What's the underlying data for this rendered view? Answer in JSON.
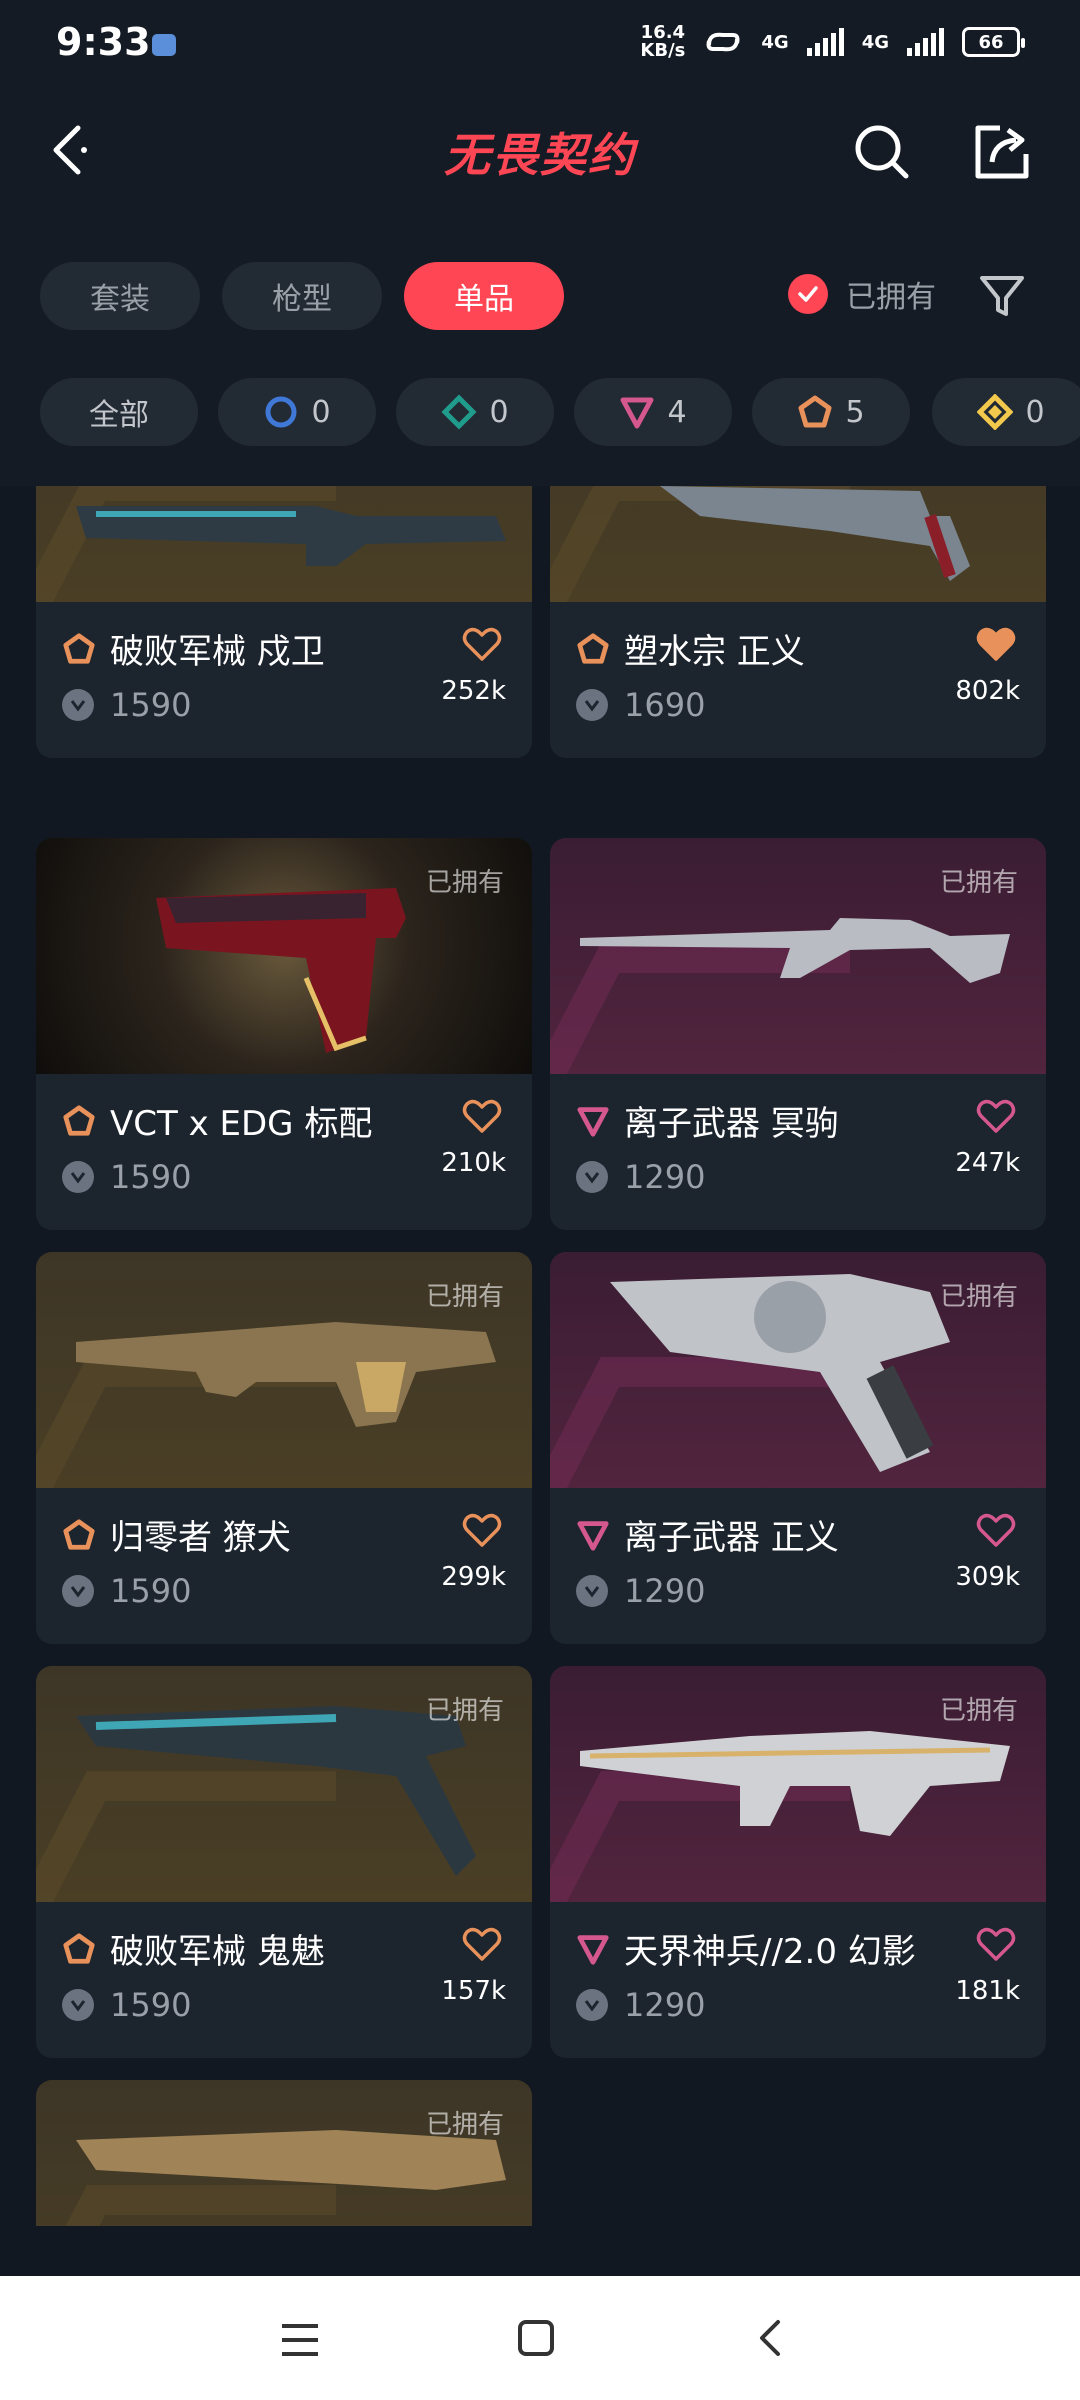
{
  "status_bar": {
    "time": "9:33",
    "net_speed_value": "16.4",
    "net_speed_unit": "KB/s",
    "signal_1": "4G",
    "signal_2": "4G",
    "battery": "66"
  },
  "header": {
    "title": "无畏契约",
    "back_icon": "chevron-left-icon",
    "search_icon": "search-icon",
    "share_icon": "share-icon"
  },
  "tabs": [
    {
      "label": "套装",
      "active": false
    },
    {
      "label": "枪型",
      "active": false
    },
    {
      "label": "单品",
      "active": true
    }
  ],
  "owned_filter": {
    "label": "已拥有",
    "checked": true
  },
  "tier_filters": [
    {
      "label": "全部",
      "icon": ""
    },
    {
      "label": "0",
      "icon": "select-tier-icon",
      "color": "#3f78d6"
    },
    {
      "label": "0",
      "icon": "deluxe-tier-icon",
      "color": "#1f9c8c"
    },
    {
      "label": "4",
      "icon": "premium-tier-icon",
      "color": "#d4578e"
    },
    {
      "label": "5",
      "icon": "exclusive-tier-icon",
      "color": "#e8915a"
    },
    {
      "label": "0",
      "icon": "ultra-tier-icon",
      "color": "#f2c94c"
    }
  ],
  "cards": [
    {
      "name": "破败军械 戍卫",
      "price": "1590",
      "count": "252k",
      "owned": "",
      "tier": "exclusive",
      "bg": "brown",
      "favorited": false
    },
    {
      "name": "塑水宗 正义",
      "price": "1690",
      "count": "802k",
      "owned": "",
      "tier": "exclusive",
      "bg": "brown",
      "favorited": true
    },
    {
      "name": "VCT x EDG 标配",
      "price": "1590",
      "count": "210k",
      "owned": "已拥有",
      "tier": "exclusive",
      "bg": "dark",
      "favorited": false
    },
    {
      "name": "离子武器 冥驹",
      "price": "1290",
      "count": "247k",
      "owned": "已拥有",
      "tier": "premium",
      "bg": "purple",
      "favorited": false
    },
    {
      "name": "归零者 獠犬",
      "price": "1590",
      "count": "299k",
      "owned": "已拥有",
      "tier": "exclusive",
      "bg": "brown",
      "favorited": false
    },
    {
      "name": "离子武器 正义",
      "price": "1290",
      "count": "309k",
      "owned": "已拥有",
      "tier": "premium",
      "bg": "purple",
      "favorited": false
    },
    {
      "name": "破败军械 鬼魅",
      "price": "1590",
      "count": "157k",
      "owned": "已拥有",
      "tier": "exclusive",
      "bg": "brown",
      "favorited": false
    },
    {
      "name": "天界神兵//2.0 幻影",
      "price": "1290",
      "count": "181k",
      "owned": "已拥有",
      "tier": "premium",
      "bg": "purple",
      "favorited": false
    },
    {
      "name": "",
      "price": "",
      "count": "",
      "owned": "已拥有",
      "tier": "exclusive",
      "bg": "brown",
      "favorited": false
    }
  ],
  "colors": {
    "accent": "#ff4655",
    "exclusive": "#e8915a",
    "premium": "#d4578e",
    "background": "#111821",
    "card": "#1c242e"
  },
  "nav_bar": {
    "menu_icon": "menu-icon",
    "home_icon": "home-square-icon",
    "back_icon": "nav-back-icon"
  }
}
